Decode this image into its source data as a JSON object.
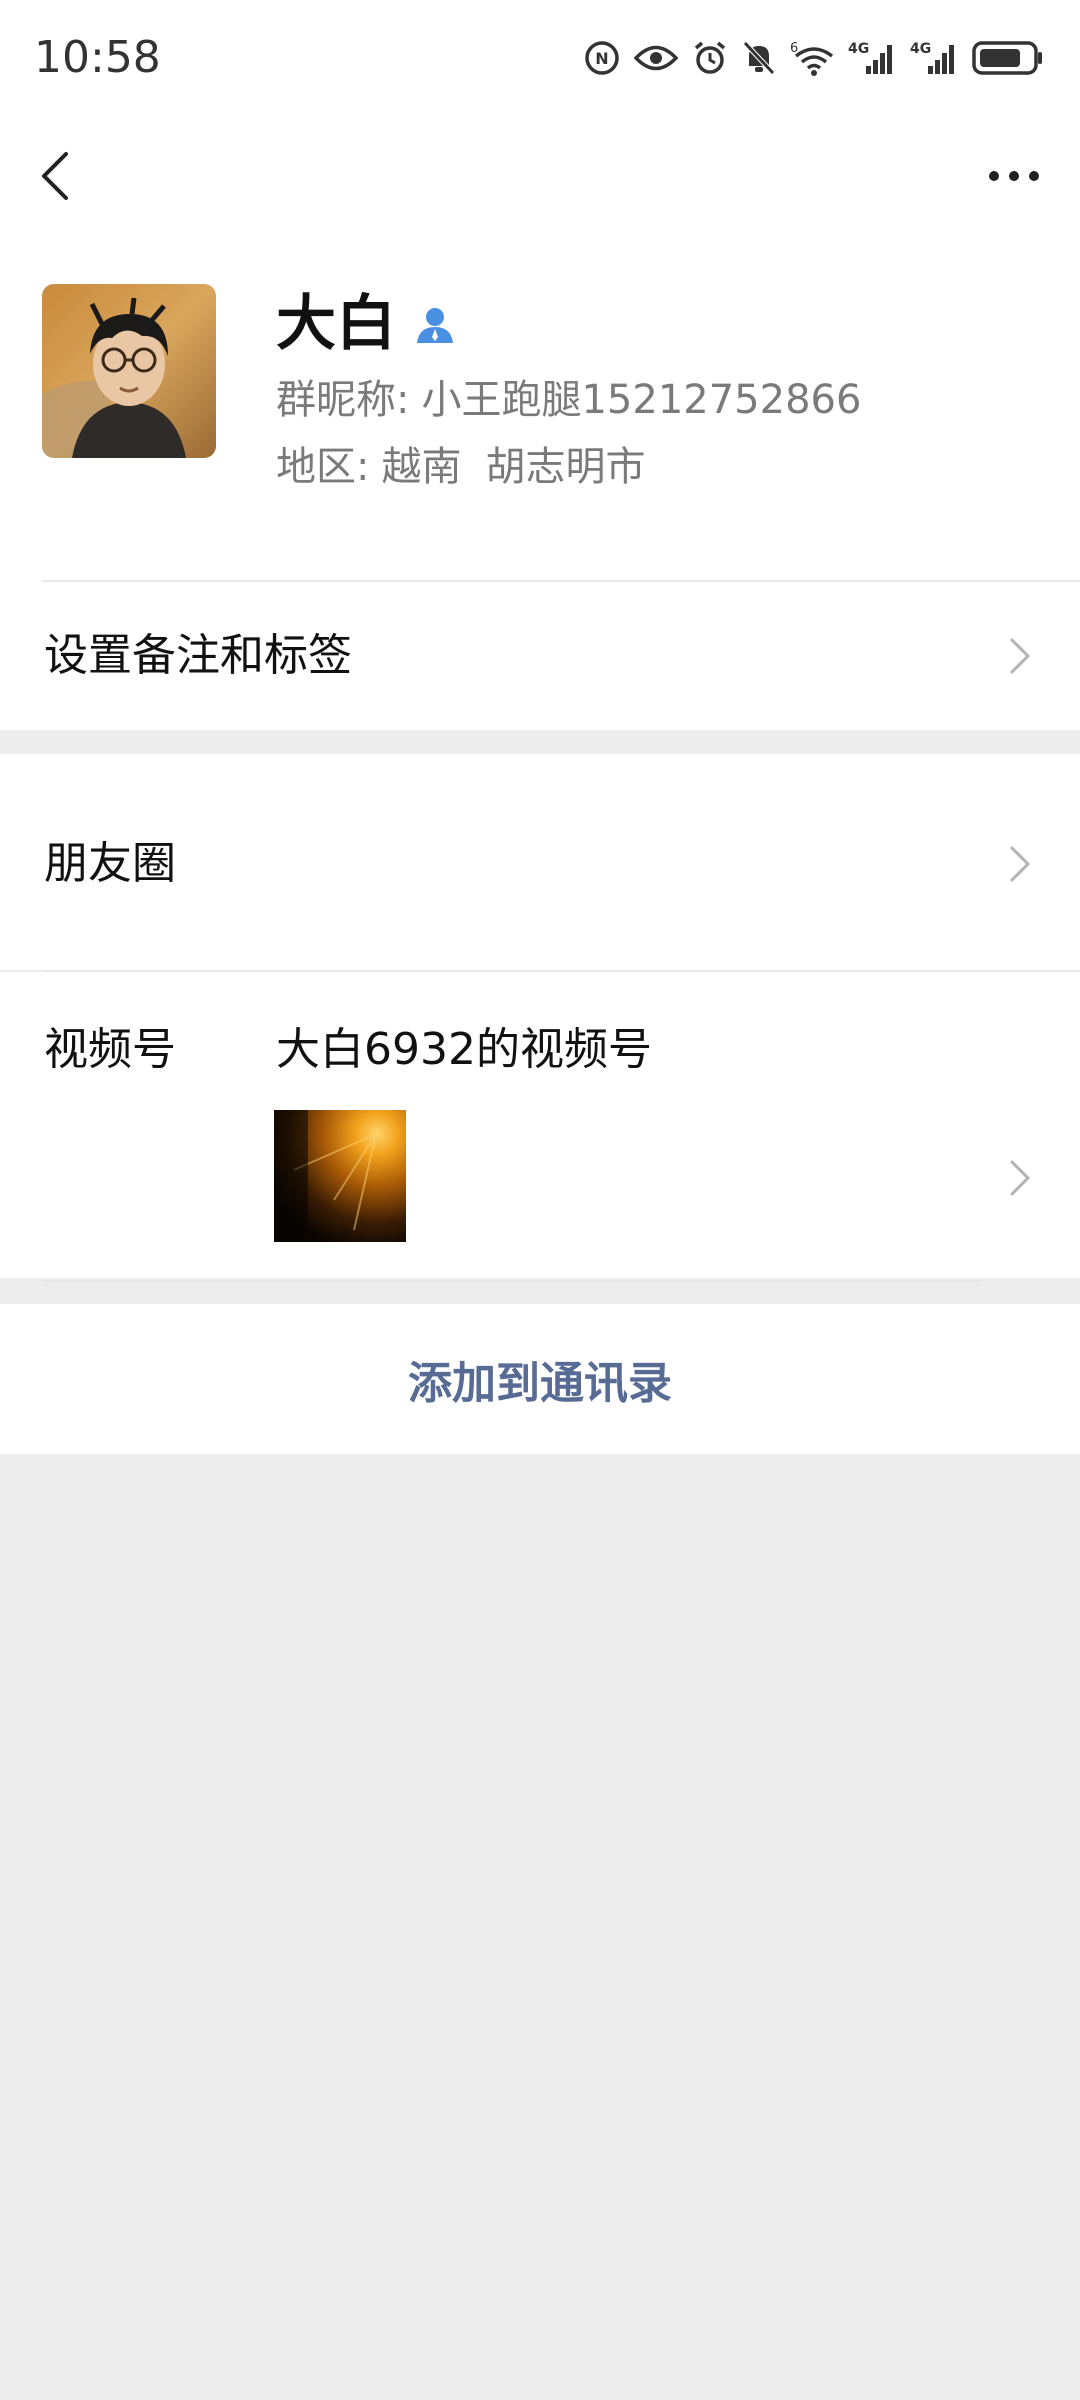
{
  "status_bar": {
    "time": "10:58",
    "signal_1": "4G",
    "signal_2": "4G",
    "wifi_badge": "6",
    "icons": [
      "nfc-icon",
      "eye-icon",
      "alarm-icon",
      "mute-icon",
      "wifi-icon",
      "signal-icon",
      "signal-icon",
      "battery-icon"
    ]
  },
  "nav": {
    "back_icon": "chevron-left-icon",
    "more_icon": "more-dots-icon"
  },
  "profile": {
    "name": "大白",
    "verify_icon": "person-badge-icon",
    "group_nickname_label": "群昵称:",
    "group_nickname": "小王跑腿15212752866",
    "region_label": "地区:",
    "region_country": "越南",
    "region_city": "胡志明市"
  },
  "rows": {
    "remark_label": "设置备注和标签",
    "moments_label": "朋友圈",
    "channels_label": "视频号",
    "channels_name": "大白6932的视频号"
  },
  "actions": {
    "add_contact": "添加到通讯录"
  },
  "colors": {
    "link": "#576b95",
    "verify": "#4a90e2",
    "background": "#ededed"
  }
}
